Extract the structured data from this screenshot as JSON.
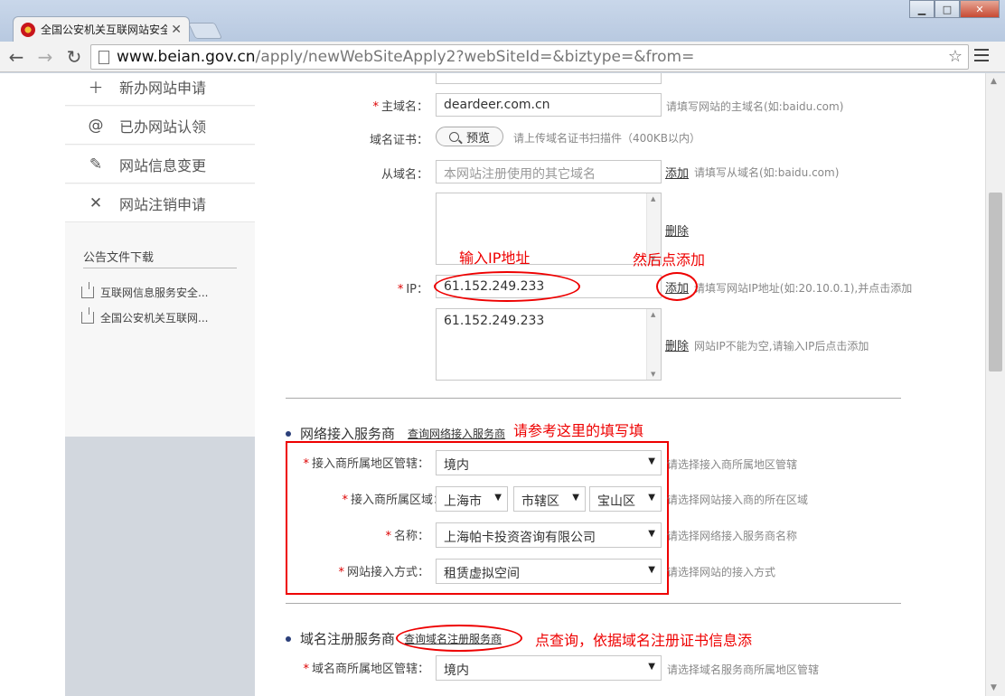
{
  "browser": {
    "tab_title": "全国公安机关互联网站安全",
    "url_host": "www.beian.gov.cn",
    "url_path": "/apply/newWebSiteApply2?webSiteId=&biztype=&from="
  },
  "sidebar": {
    "items": [
      {
        "icon": "plus-icon",
        "label": "新办网站申请"
      },
      {
        "icon": "at-icon",
        "label": "已办网站认领"
      },
      {
        "icon": "edit-icon",
        "label": "网站信息变更"
      },
      {
        "icon": "close-icon",
        "label": "网站注销申请"
      }
    ],
    "notice_title": "公告文件下载",
    "notices": [
      "互联网信息服务安全...",
      "全国公安机关互联网..."
    ]
  },
  "form": {
    "main_domain": {
      "label": "主域名：",
      "value": "deardeer.com.cn",
      "hint": "请填写网站的主域名(如:baidu.com)"
    },
    "domain_cert": {
      "label": "域名证书：",
      "button": "预览",
      "hint": "请上传域名证书扫描件（400KB以内）"
    },
    "sub_domain": {
      "label": "从域名：",
      "placeholder": "本网站注册使用的其它域名",
      "add": "添加",
      "hint": "请填写从域名(如:baidu.com)",
      "delete": "删除"
    },
    "ip": {
      "label": "IP：",
      "value": "61.152.249.233",
      "add": "添加",
      "hint": "请填写网站IP地址(如:20.10.0.1),并点击添加",
      "list_value": "61.152.249.233",
      "delete": "删除",
      "list_hint": "网站IP不能为空,请输入IP后点击添加"
    }
  },
  "isp_section": {
    "title": "网络接入服务商",
    "query_link": "查询网络接入服务商",
    "region": {
      "label": "接入商所属地区管辖：",
      "value": "境内",
      "hint": "请选择接入商所属地区管辖"
    },
    "area": {
      "label": "接入商所属区域：",
      "province": "上海市",
      "city": "市辖区",
      "district": "宝山区",
      "hint": "请选择网站接入商的所在区域"
    },
    "name": {
      "label": "名称：",
      "value": "上海帕卡投资咨询有限公司",
      "hint": "请选择网络接入服务商名称"
    },
    "method": {
      "label": "网站接入方式：",
      "value": "租赁虚拟空间",
      "hint": "请选择网站的接入方式"
    }
  },
  "registrar_section": {
    "title": "域名注册服务商",
    "query_link": "查询域名注册服务商",
    "region": {
      "label": "域名商所属地区管辖：",
      "value": "境内",
      "hint": "请选择域名服务商所属地区管辖"
    }
  },
  "annotations": {
    "enter_ip": "输入IP地址",
    "then_add": "然后点添加",
    "refer_here": "请参考这里的填写填",
    "click_query": "点查询，依据域名注册证书信息添"
  },
  "colors": {
    "annotation": "#ee0000",
    "required": "#dd0000",
    "bullet": "#2b3f7a"
  }
}
